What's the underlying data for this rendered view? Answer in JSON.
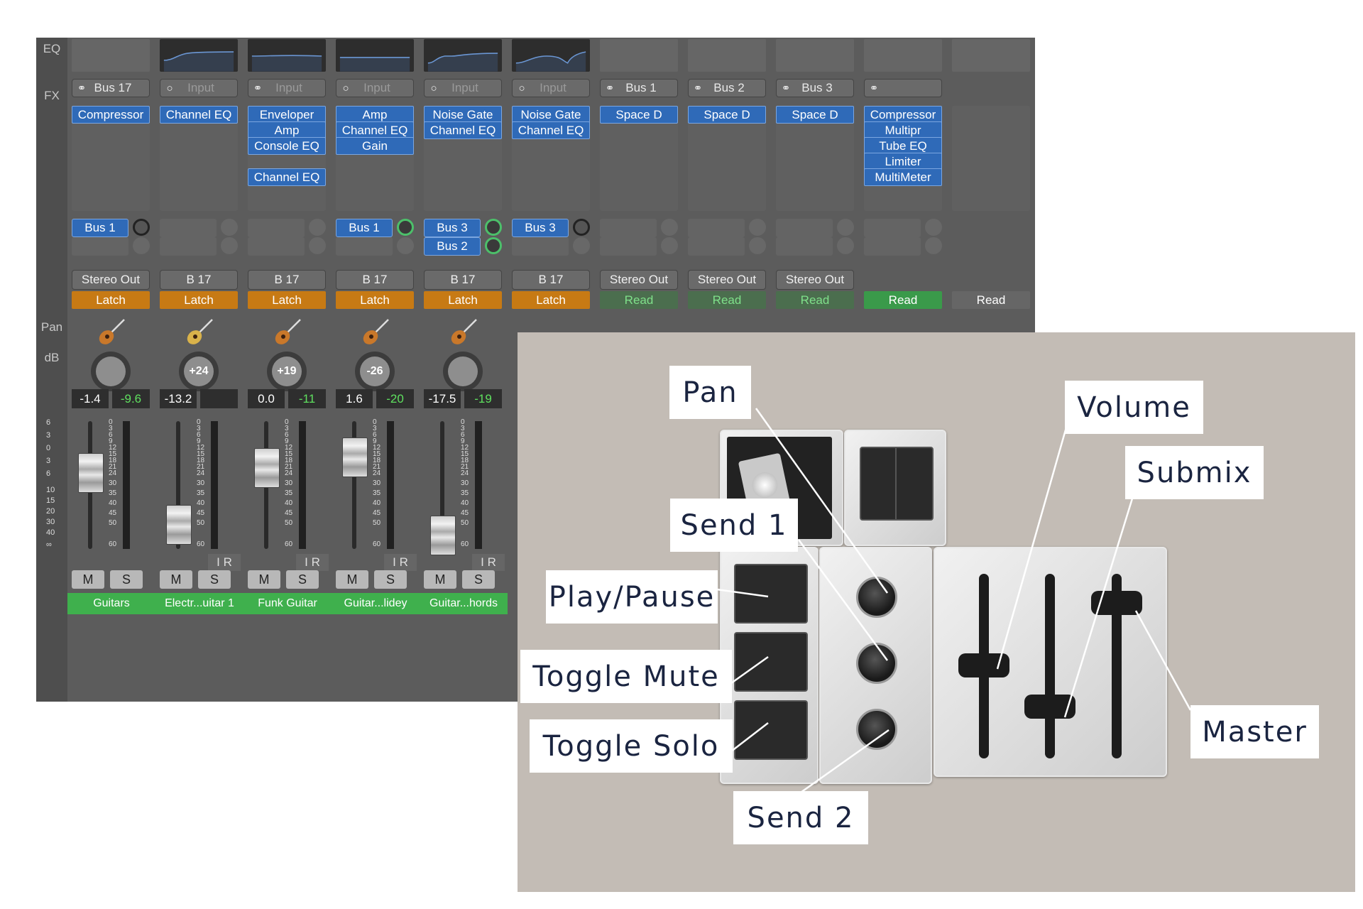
{
  "mixer": {
    "side_labels": {
      "eq": "EQ",
      "fx": "FX",
      "pan": "Pan",
      "db": "dB"
    },
    "scale_left": [
      "6",
      "3",
      "0",
      "3",
      "6",
      "10",
      "15",
      "20",
      "30",
      "40",
      "∞"
    ],
    "scale_right": [
      "0",
      "3",
      "6",
      "9",
      "12",
      "15",
      "18",
      "21",
      "24",
      "30",
      "35",
      "40",
      "45",
      "50",
      "60"
    ],
    "strips": [
      {
        "input": "Bus 17",
        "input_icon": "link",
        "plugins": [
          "Compressor"
        ],
        "sends": [
          "Bus 1"
        ],
        "output": "Stereo Out",
        "automation": "Latch",
        "pan": "",
        "db_a": "-1.4",
        "db_b": "-9.6",
        "mute": "M",
        "solo": "S",
        "ir": "",
        "name": "Guitars"
      },
      {
        "input": "Input",
        "input_icon": "ring",
        "plugins": [
          "Channel EQ"
        ],
        "sends": [],
        "output": "B 17",
        "automation": "Latch",
        "pan": "+24",
        "db_a": "-13.2",
        "db_b": "",
        "mute": "M",
        "solo": "S",
        "ir": "I R",
        "name": "Electr...uitar 1"
      },
      {
        "input": "Input",
        "input_icon": "link",
        "plugins": [
          "Enveloper",
          "Amp",
          "Console EQ",
          "",
          "Channel EQ"
        ],
        "sends": [],
        "output": "B 17",
        "automation": "Latch",
        "pan": "+19",
        "db_a": "0.0",
        "db_b": "-11",
        "mute": "M",
        "solo": "S",
        "ir": "I R",
        "name": "Funk Guitar"
      },
      {
        "input": "Input",
        "input_icon": "ring",
        "plugins": [
          "Amp",
          "Channel EQ",
          "Gain"
        ],
        "sends": [
          "Bus 1"
        ],
        "output": "B 17",
        "automation": "Latch",
        "pan": "-26",
        "db_a": "1.6",
        "db_b": "-20",
        "mute": "M",
        "solo": "S",
        "ir": "I R",
        "name": "Guitar...lidey"
      },
      {
        "input": "Input",
        "input_icon": "ring",
        "plugins": [
          "Noise Gate",
          "Channel EQ"
        ],
        "sends": [
          "Bus 3",
          "Bus 2"
        ],
        "output": "B 17",
        "automation": "Latch",
        "pan": "",
        "db_a": "-17.5",
        "db_b": "-19",
        "mute": "M",
        "solo": "S",
        "ir": "I R",
        "name": "Guitar...hords"
      },
      {
        "input": "Input",
        "input_icon": "ring",
        "plugins": [
          "Noise Gate",
          "Channel EQ"
        ],
        "sends": [
          "Bus 3"
        ],
        "output": "B 17",
        "automation": "Latch",
        "name": ""
      },
      {
        "input": "Bus 1",
        "input_icon": "link",
        "plugins": [
          "Space D"
        ],
        "sends": [],
        "output": "Stereo Out",
        "automation": "Read",
        "name": ""
      },
      {
        "input": "Bus 2",
        "input_icon": "link",
        "plugins": [
          "Space D"
        ],
        "sends": [],
        "output": "Stereo Out",
        "automation": "Read",
        "name": ""
      },
      {
        "input": "Bus 3",
        "input_icon": "link",
        "plugins": [
          "Space D"
        ],
        "sends": [],
        "output": "Stereo Out",
        "automation": "Read",
        "name": ""
      },
      {
        "input": "",
        "input_icon": "link",
        "plugins": [
          "Compressor",
          "Multipr",
          "Tube EQ",
          "Limiter",
          "MultiMeter"
        ],
        "sends": [],
        "output": "",
        "automation": "Read",
        "name": ""
      },
      {
        "input": "",
        "input_icon": "",
        "plugins": [],
        "sends": [],
        "output": "",
        "automation": "Read",
        "name": ""
      }
    ]
  },
  "panel": {
    "callouts": {
      "pan": "Pan",
      "volume": "Volume",
      "submix": "Submix",
      "send1": "Send 1",
      "play_pause": "Play/Pause",
      "toggle_mute": "Toggle Mute",
      "toggle_solo": "Toggle Solo",
      "master": "Master",
      "send2": "Send 2"
    }
  },
  "colors": {
    "latch": "#c77a14",
    "read": "#4b6e4e",
    "plugin": "#2f6ab8",
    "track_name": "#3fb04d",
    "panel_bg": "#c3bcb5"
  },
  "icons": {
    "input_link": "link-icon",
    "input_ring": "ring-icon",
    "guitar": "guitar-icon"
  }
}
